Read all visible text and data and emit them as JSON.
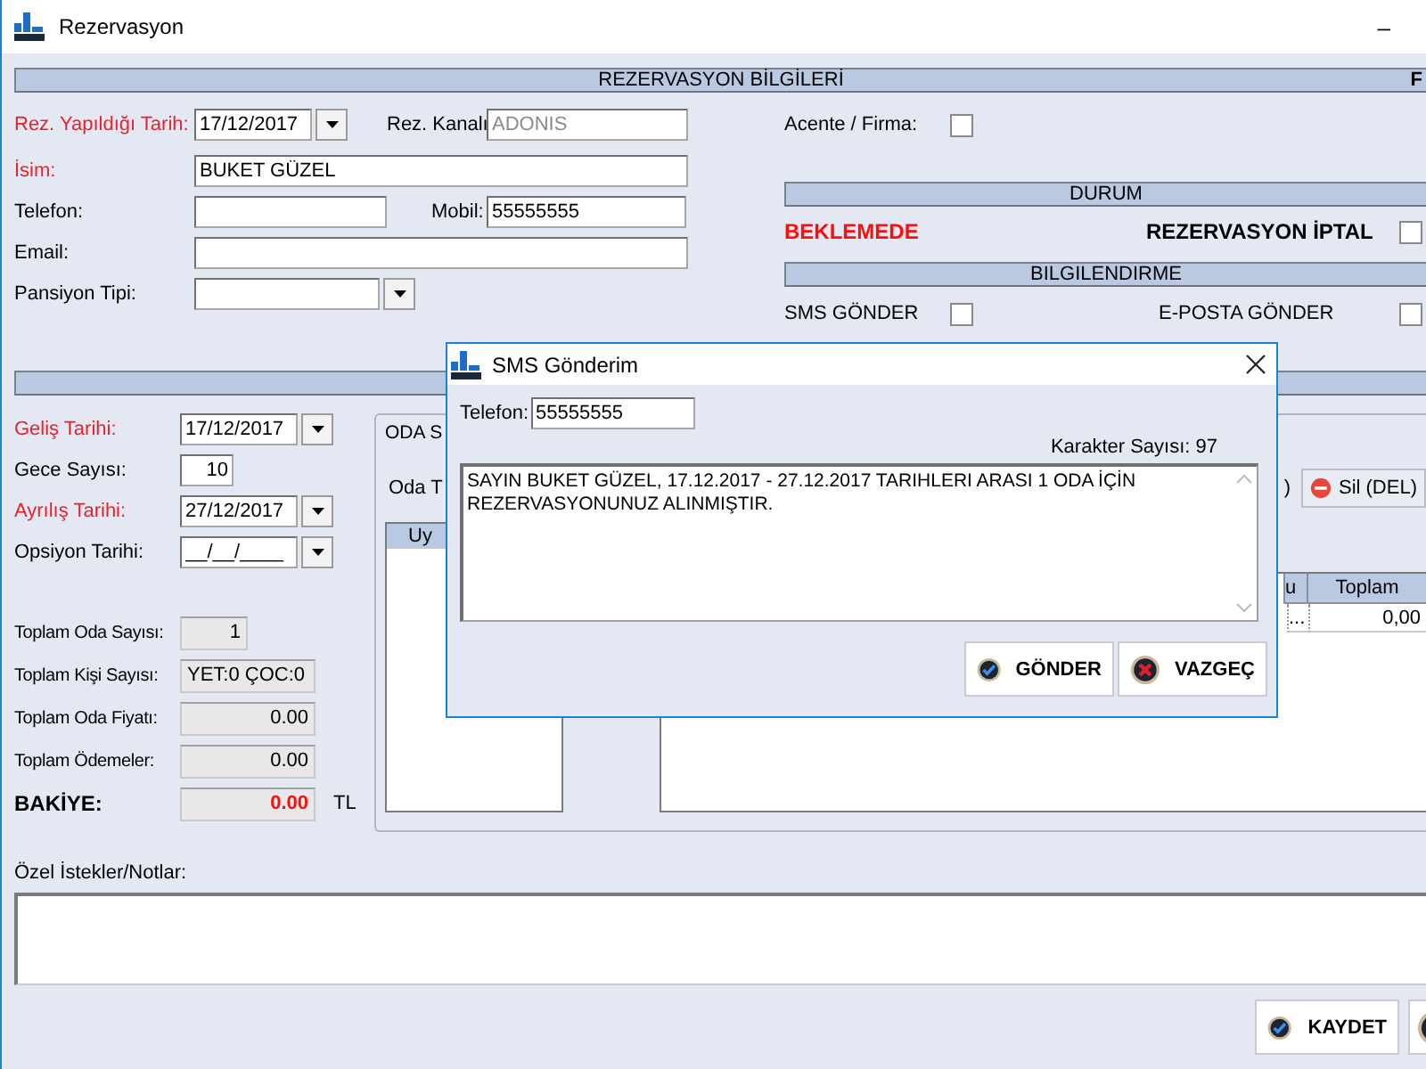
{
  "window": {
    "title": "Rezervasyon",
    "minimize": "–"
  },
  "reservation_header": {
    "title": "REZERVASYON BİLGİLERİ",
    "cut_heading": "F"
  },
  "reservation": {
    "date_label": "Rez. Yapıldığı Tarih:",
    "date": "17/12/2017",
    "channel_label": "Rez. Kanalı",
    "channel": "ADONIS",
    "name_label": "İsim:",
    "name": "BUKET GÜZEL",
    "phone_label": "Telefon:",
    "mobile_label": "Mobil:",
    "mobile": "55555555",
    "email_label": "Email:",
    "board_label": "Pansiyon Tipi:",
    "agency_label": "Acente / Firma:",
    "agency_checked": false
  },
  "status": {
    "title": "DURUM",
    "state": "BEKLEMEDE",
    "cancel_label": "REZERVASYON İPTAL",
    "cancel_checked": false
  },
  "notify": {
    "title": "BILGILENDIRME",
    "sms_label": "SMS GÖNDER",
    "sms_checked": false,
    "email_label": "E-POSTA GÖNDER",
    "email_checked": false
  },
  "stay": {
    "arrival_label": "Geliş Tarihi:",
    "arrival": "17/12/2017",
    "nights_label": "Gece Sayısı:",
    "nights": "10",
    "departure_label": "Ayrılış Tarihi:",
    "departure": "27/12/2017",
    "option_label": "Opsiyon Tarihi:",
    "option": "__/__/____"
  },
  "totals": [
    {
      "kind": "count",
      "label": "Toplam Oda Sayısı:",
      "value": "1"
    },
    {
      "kind": "text",
      "label": "Toplam Kişi Sayısı:",
      "value": "YET:0 ÇOC:0"
    },
    {
      "kind": "amount",
      "label": "Toplam Oda Fiyatı:",
      "value": "0.00"
    },
    {
      "kind": "amount",
      "label": "Toplam Ödemeler:",
      "value": "0.00"
    },
    {
      "kind": "balance",
      "label": "BAKİYE:",
      "value": "0.00",
      "unit": "TL"
    }
  ],
  "rooms": {
    "group_title": "ODA S",
    "type_label": "Oda T",
    "list_header": "Uy",
    "button_fragment": ")",
    "delete_button": "Sil (DEL)",
    "columns": [
      "u",
      "Toplam"
    ],
    "row": [
      "...",
      "0,00"
    ]
  },
  "notes": {
    "label": "Özel İstekler/Notlar:"
  },
  "buttons": [
    "KAYDET"
  ],
  "sms_dialog": {
    "title": "SMS Gönderim",
    "phone_label": "Telefon:",
    "phone": "55555555",
    "char_count": "Karakter Sayısı: 97",
    "message": "SAYIN BUKET GÜZEL, 17.12.2017 - 27.12.2017 TARIHLERI ARASI 1 ODA İÇİN REZERVASYONUNUZ ALINMIŞTIR.",
    "buttons": [
      {
        "label": "GÖNDER",
        "kind": "ok"
      },
      {
        "label": "VAZGEÇ",
        "kind": "cancel"
      }
    ]
  }
}
